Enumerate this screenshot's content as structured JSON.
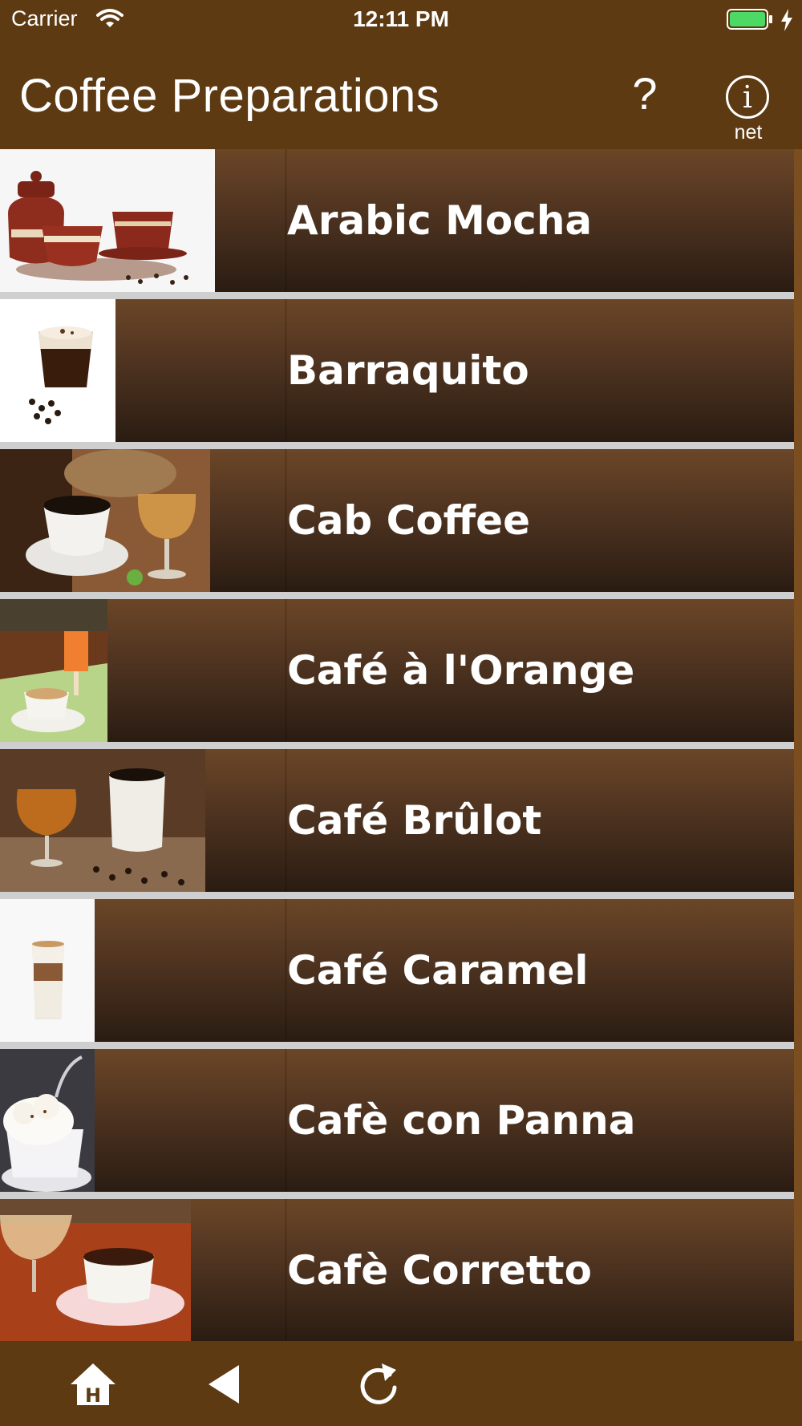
{
  "status_bar": {
    "carrier": "Carrier",
    "time": "12:11 PM"
  },
  "header": {
    "title": "Coffee Preparations",
    "help_label": "?",
    "info_glyph": "i",
    "info_label": "net"
  },
  "items": [
    {
      "label": "Arabic Mocha",
      "thumb": "coffee-pots-image"
    },
    {
      "label": "Barraquito",
      "thumb": "layered-glass-image"
    },
    {
      "label": "Cab Coffee",
      "thumb": "coffee-and-brandy-image"
    },
    {
      "label": "Café à l'Orange",
      "thumb": "cafe-orange-image"
    },
    {
      "label": "Café Brûlot",
      "thumb": "brandy-and-mug-image"
    },
    {
      "label": "Café Caramel",
      "thumb": "latte-glass-image"
    },
    {
      "label": "Cafè con Panna",
      "thumb": "whipped-cream-cup-image"
    },
    {
      "label": "Cafè Corretto",
      "thumb": "espresso-and-glass-image"
    }
  ],
  "toolbar": {
    "home_letter": "H"
  },
  "colors": {
    "bar": "#5d3a11",
    "row_top": "#6b4627",
    "row_bottom": "#2a1c12",
    "separator": "#cfcfcf"
  }
}
